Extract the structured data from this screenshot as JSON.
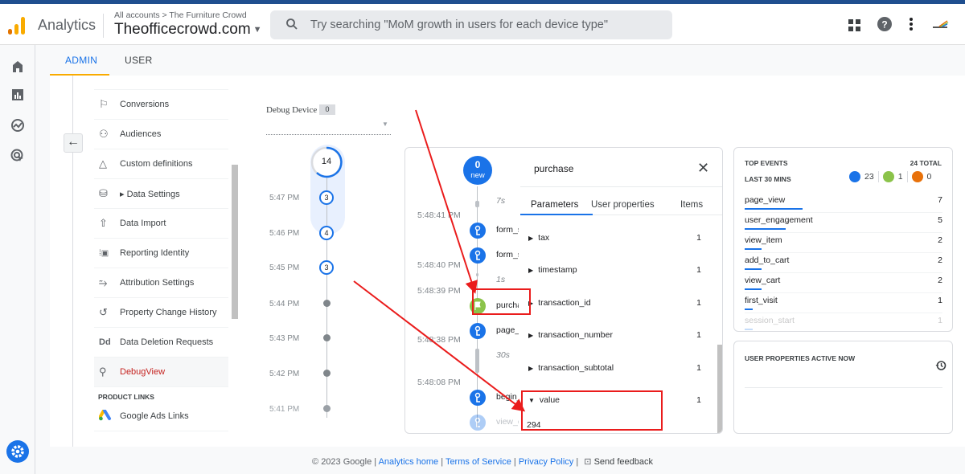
{
  "header": {
    "app_name": "Analytics",
    "breadcrumb": "All accounts > The Furniture Crowd",
    "property": "Theofficecrowd.com",
    "search_placeholder": "Try searching \"MoM growth in users for each device type\"",
    "icons": [
      "apps-grid-icon",
      "help-icon",
      "more-vert-icon",
      "account-avatar"
    ]
  },
  "tabs": [
    {
      "label": "ADMIN",
      "active": true
    },
    {
      "label": "USER",
      "active": false
    }
  ],
  "left_nav": [
    "home-icon",
    "reports-icon",
    "explore-icon",
    "advertising-icon"
  ],
  "admin_menu": {
    "items": [
      {
        "label": "Conversions",
        "icon": "flag-icon"
      },
      {
        "label": "Audiences",
        "icon": "audiences-icon"
      },
      {
        "label": "Custom definitions",
        "icon": "shapes-icon"
      },
      {
        "label": "▸ Data Settings",
        "icon": "database-icon"
      },
      {
        "label": "Data Import",
        "icon": "upload-icon"
      },
      {
        "label": "Reporting Identity",
        "icon": "identity-icon"
      },
      {
        "label": "Attribution Settings",
        "icon": "route-icon"
      },
      {
        "label": "Property Change History",
        "icon": "history-icon"
      },
      {
        "label": "Data Deletion Requests",
        "icon": "dd-icon"
      },
      {
        "label": "DebugView",
        "icon": "debug-icon",
        "active": true
      }
    ],
    "product_links_header": "PRODUCT LINKS",
    "product_links": [
      {
        "label": "Google Ads Links",
        "icon": "google-ads-icon"
      }
    ]
  },
  "debug": {
    "device_label": "Debug Device",
    "device_count": "0",
    "minutes_total": "14",
    "minutes": [
      {
        "time": "5:47 PM",
        "count": "3"
      },
      {
        "time": "5:46 PM",
        "count": "4"
      },
      {
        "time": "5:45 PM",
        "count": "3"
      },
      {
        "time": "5:44 PM",
        "count": ""
      },
      {
        "time": "5:43 PM",
        "count": ""
      },
      {
        "time": "5:42 PM",
        "count": ""
      },
      {
        "time": "5:41 PM",
        "count": ""
      }
    ]
  },
  "seconds_stream": {
    "new_count": "0",
    "new_label": "new",
    "gaps": [
      "7s",
      "1s",
      "30s"
    ],
    "times": [
      "5:48:41 PM",
      "5:48:40 PM",
      "5:48:39 PM",
      "5:48:38 PM",
      "5:48:08 PM"
    ],
    "events": [
      {
        "name": "form_start",
        "type": "event"
      },
      {
        "name": "form_submit",
        "type": "event"
      },
      {
        "name": "purchase",
        "type": "conversion"
      },
      {
        "name": "page_view",
        "type": "event"
      },
      {
        "name": "begin_checkout",
        "type": "event"
      },
      {
        "name": "view_cart",
        "type": "event"
      }
    ]
  },
  "event_detail": {
    "title": "purchase",
    "tabs": [
      "Parameters",
      "User properties",
      "Items"
    ],
    "params": [
      {
        "name": "tax",
        "count": "1"
      },
      {
        "name": "timestamp",
        "count": "1"
      },
      {
        "name": "transaction_id",
        "count": "1"
      },
      {
        "name": "transaction_number",
        "count": "1"
      },
      {
        "name": "transaction_subtotal",
        "count": "1"
      },
      {
        "name": "value",
        "count": "1",
        "expanded": true,
        "value": "294"
      }
    ]
  },
  "top_events": {
    "title": "TOP EVENTS",
    "total": "24 TOTAL",
    "subtitle": "LAST 30 MINS",
    "counts": {
      "events": "23",
      "conversions": "1",
      "errors": "0"
    },
    "colors": {
      "event": "#1a73e8",
      "conversion": "#8bc34a",
      "error": "#e8710a"
    },
    "rows": [
      {
        "name": "page_view",
        "count": "7",
        "value": 7
      },
      {
        "name": "user_engagement",
        "count": "5",
        "value": 5
      },
      {
        "name": "view_item",
        "count": "2",
        "value": 2
      },
      {
        "name": "add_to_cart",
        "count": "2",
        "value": 2
      },
      {
        "name": "view_cart",
        "count": "2",
        "value": 2
      },
      {
        "name": "first_visit",
        "count": "1",
        "value": 1
      },
      {
        "name": "session_start",
        "count": "1",
        "value": 1
      }
    ]
  },
  "user_properties": {
    "title": "USER PROPERTIES ACTIVE NOW"
  },
  "footer": {
    "copyright": "© 2023 Google |",
    "links": [
      "Analytics home",
      "Terms of Service",
      "Privacy Policy"
    ],
    "feedback": "Send feedback"
  }
}
